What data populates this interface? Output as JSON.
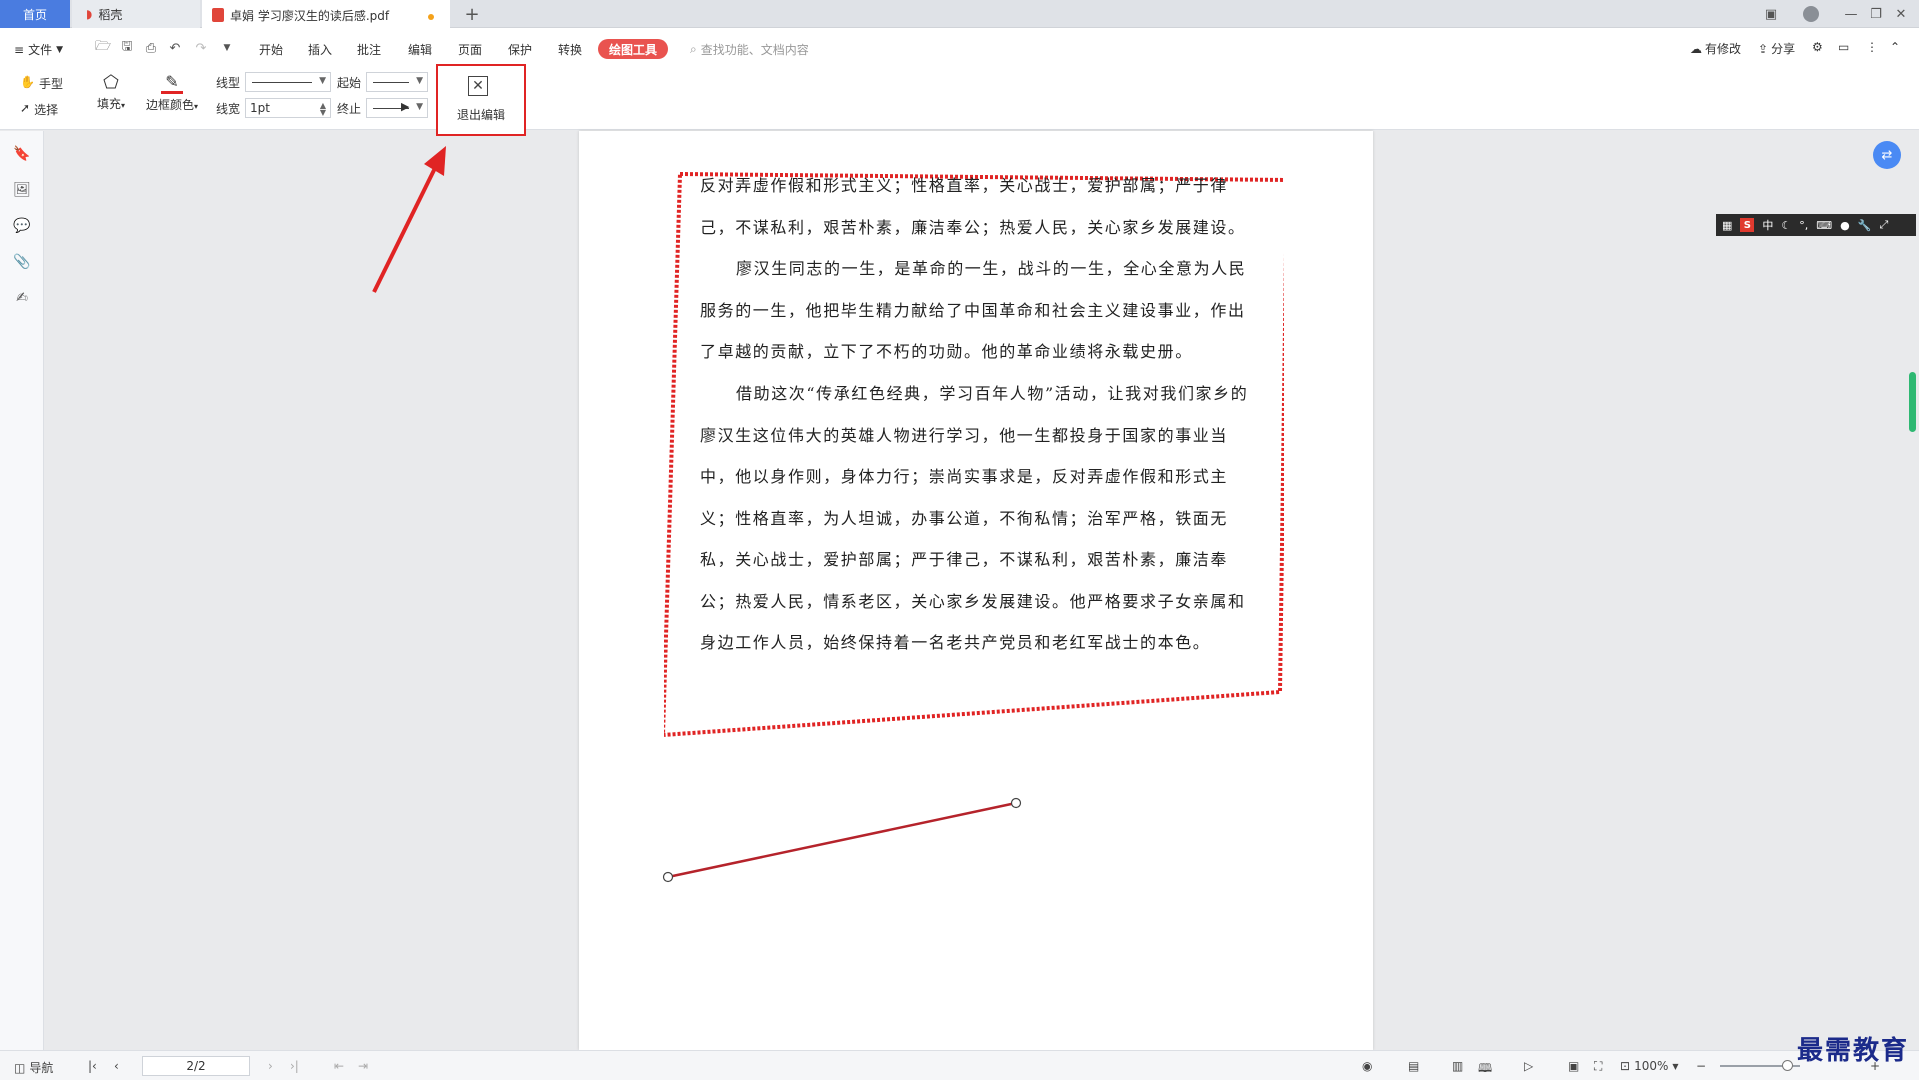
{
  "tabs": {
    "home": "首页",
    "daoke": "稻壳",
    "document": "卓娟 学习廖汉生的读后感.pdf",
    "add": "+"
  },
  "menu": {
    "file": "文件",
    "items": [
      "开始",
      "插入",
      "批注",
      "编辑",
      "页面",
      "保护",
      "转换"
    ],
    "drawing_tools": "绘图工具",
    "search_placeholder": "查找功能、文档内容",
    "has_changes": "有修改",
    "share": "分享"
  },
  "ribbon": {
    "hand": "手型",
    "select": "选择",
    "fill": "填充",
    "border_color": "边框颜色",
    "line_type": "线型",
    "line_width": "线宽",
    "line_width_value": "1pt",
    "start": "起始",
    "end": "终止",
    "exit_edit": "退出编辑"
  },
  "document": {
    "paragraphs": [
      "反对弄虚作假和形式主义；性格直率，关心战士，爱护部属；严于律己，不谋私利，艰苦朴素，廉洁奉公；热爱人民，关心家乡发展建设。",
      "廖汉生同志的一生，是革命的一生，战斗的一生，全心全意为人民服务的一生，他把毕生精力献给了中国革命和社会主义建设事业，作出了卓越的贡献，立下了不朽的功勋。他的革命业绩将永载史册。",
      "借助这次“传承红色经典，学习百年人物”活动，让我对我们家乡的廖汉生这位伟大的英雄人物进行学习，他一生都投身于国家的事业当中，他以身作则，身体力行；崇尚实事求是，反对弄虚作假和形式主义；性格直率，为人坦诚，办事公道，不徇私情；治军严格，铁面无私，关心战士，爱护部属；严于律己，不谋私利，艰苦朴素，廉洁奉公；热爱人民，情系老区，关心家乡发展建设。他严格要求子女亲属和身边工作人员，始终保持着一名老共产党员和老红军战士的本色。"
    ]
  },
  "ime": {
    "mode": "中",
    "logo": "S"
  },
  "status": {
    "nav": "导航",
    "page": "2/2",
    "zoom": "100%"
  },
  "watermark": "最需教育",
  "colors": {
    "accent_red": "#e02424",
    "tab_blue": "#4a7ce0",
    "scroll_green": "#2eb872"
  }
}
